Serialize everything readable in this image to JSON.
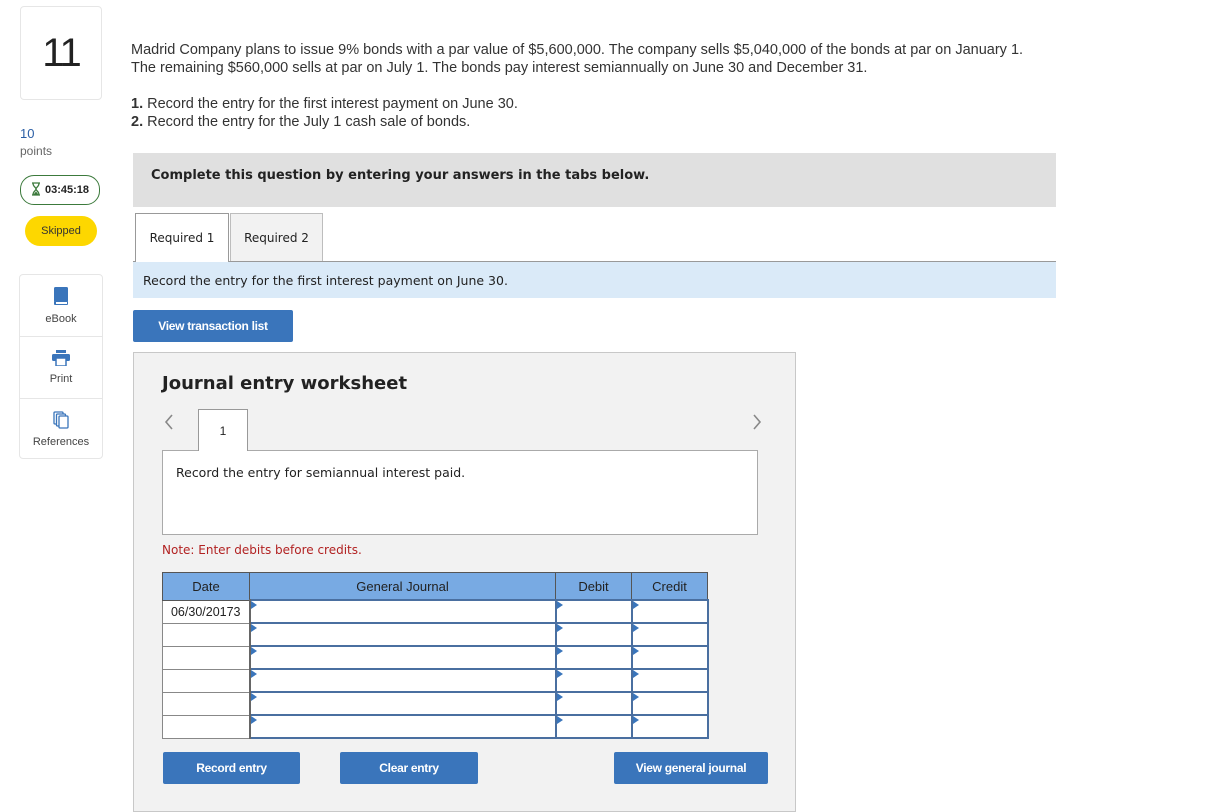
{
  "sidebar": {
    "question_number": "11",
    "points_value": "10",
    "points_label": "points",
    "timer": "03:45:18",
    "status_badge": "Skipped",
    "tools": [
      {
        "label": "eBook",
        "icon": "book-icon"
      },
      {
        "label": "Print",
        "icon": "printer-icon"
      },
      {
        "label": "References",
        "icon": "copy-documents-icon"
      }
    ]
  },
  "question": {
    "text": "Madrid Company plans to issue 9% bonds with a par value of $5,600,000. The company sells $5,040,000 of the bonds at par on January 1. The remaining $560,000 sells at par on July 1. The bonds pay interest semiannually on June 30 and December 31.",
    "items": [
      {
        "num": "1.",
        "text": " Record the entry for the first interest payment on June 30."
      },
      {
        "num": "2.",
        "text": " Record the entry for the July 1 cash sale of bonds."
      }
    ]
  },
  "banner": "Complete this question by entering your answers in the tabs below.",
  "tabs": [
    {
      "label": "Required 1",
      "active": true
    },
    {
      "label": "Required 2",
      "active": false
    }
  ],
  "instruction": "Record the entry for the first interest payment on June 30.",
  "view_transaction_list": "View transaction list",
  "worksheet": {
    "title": "Journal entry worksheet",
    "prev_icon": "chevron-left-icon",
    "next_icon": "chevron-right-icon",
    "page": "1",
    "description": "Record the entry for semiannual interest paid.",
    "note": "Note: Enter debits before credits.",
    "columns": [
      "Date",
      "General Journal",
      "Debit",
      "Credit"
    ],
    "rows": [
      {
        "date": "06/30/20173",
        "account": "",
        "debit": "",
        "credit": ""
      },
      {
        "date": "",
        "account": "",
        "debit": "",
        "credit": ""
      },
      {
        "date": "",
        "account": "",
        "debit": "",
        "credit": ""
      },
      {
        "date": "",
        "account": "",
        "debit": "",
        "credit": ""
      },
      {
        "date": "",
        "account": "",
        "debit": "",
        "credit": ""
      },
      {
        "date": "",
        "account": "",
        "debit": "",
        "credit": ""
      }
    ],
    "buttons": {
      "record": "Record entry",
      "clear": "Clear entry",
      "view_journal": "View general journal"
    }
  },
  "colors": {
    "accent_blue": "#3a75bb",
    "header_blue": "#78aae3",
    "skipped_yellow": "#fdd700",
    "timer_green": "#3c7a3c",
    "note_red": "#b22222"
  }
}
